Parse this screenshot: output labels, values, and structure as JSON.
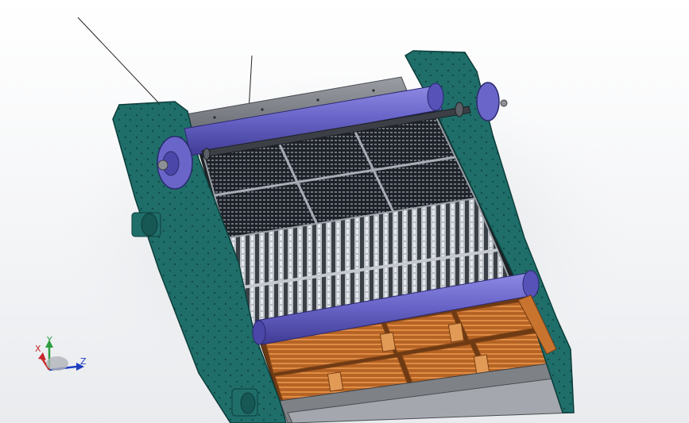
{
  "viewport": {
    "background": "#f2f3f5"
  },
  "model": {
    "frame_color": "#1f6e6a",
    "roller_color": "#6a66c9",
    "screen_panel_color": "#2b2f36",
    "finger_panel_color": "#c8742f",
    "trough_color": "#8a8d92"
  },
  "triad": {
    "x_label": "X",
    "y_label": "Y",
    "z_label": "Z",
    "x_color": "#c62828",
    "y_color": "#2e9e3f",
    "z_color": "#1f3fbf"
  }
}
